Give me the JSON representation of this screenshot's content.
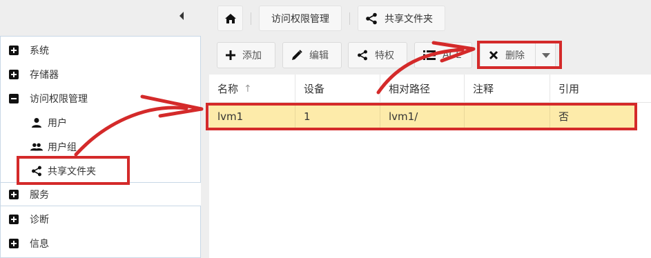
{
  "breadcrumb": {
    "home_icon": "home-icon",
    "items": [
      {
        "label": "访问权限管理"
      },
      {
        "label": "共享文件夹",
        "icon": "share-icon"
      }
    ]
  },
  "sidebar": {
    "items": [
      {
        "label": "系统",
        "expander": "plus"
      },
      {
        "label": "存储器",
        "expander": "plus"
      },
      {
        "label": "访问权限管理",
        "expander": "minus"
      },
      {
        "label": "用户",
        "icon": "user-icon"
      },
      {
        "label": "用户组",
        "icon": "users-icon"
      },
      {
        "label": "共享文件夹",
        "icon": "share-icon"
      },
      {
        "label": "服务",
        "expander": "plus"
      },
      {
        "label": "诊断",
        "expander": "plus"
      },
      {
        "label": "信息",
        "expander": "plus"
      }
    ]
  },
  "toolbar": {
    "add_label": "添加",
    "edit_label": "编辑",
    "privilege_label": "特权",
    "acl_label": "ACL",
    "delete_label": "删除"
  },
  "table": {
    "columns": [
      "名称",
      "设备",
      "相对路径",
      "注释",
      "引用"
    ],
    "sort_indicator": "↑",
    "rows": [
      {
        "name": "lvm1",
        "device": "1",
        "path": "lvm1/",
        "comment": "",
        "referenced": "否"
      }
    ]
  },
  "annotation_color": "#d42a2a",
  "selection_color": "#fdebaa"
}
